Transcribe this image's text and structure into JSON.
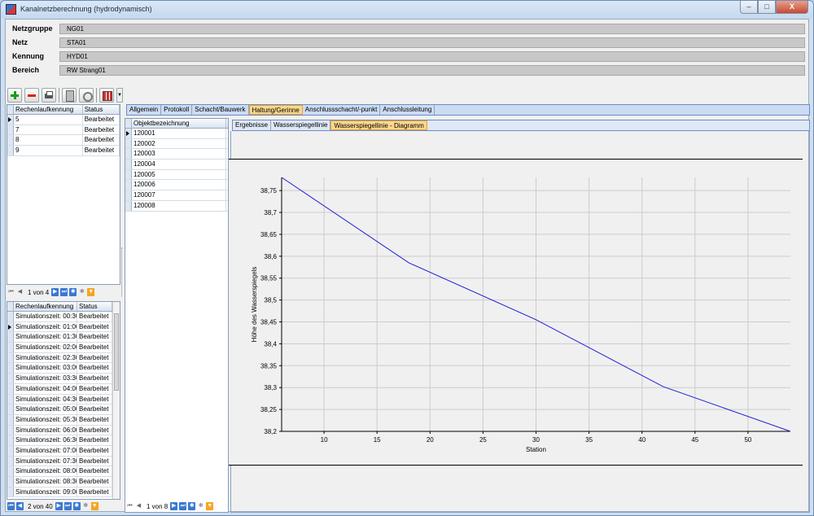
{
  "window": {
    "title": "Kanalnetzberechnung (hydrodynamisch)",
    "controls": [
      "–",
      "□",
      "X"
    ]
  },
  "header": {
    "rows": [
      {
        "label": "Netzgruppe",
        "value": "NG01"
      },
      {
        "label": "Netz",
        "value": "STA01"
      },
      {
        "label": "Kennung",
        "value": "HYD01"
      },
      {
        "label": "Bereich",
        "value": "RW Strang01"
      }
    ]
  },
  "toolbar": {
    "icons": [
      "add-icon",
      "delete-icon",
      "print-icon",
      "calculator-icon",
      "link-icon",
      "grid-icon"
    ]
  },
  "runs_grid": {
    "columns": [
      "Rechenlaufkennung",
      "Status"
    ],
    "rows": [
      {
        "id": "5",
        "status": "Bearbeitet"
      },
      {
        "id": "7",
        "status": "Bearbeitet"
      },
      {
        "id": "8",
        "status": "Bearbeitet"
      },
      {
        "id": "9",
        "status": "Bearbeitet"
      }
    ],
    "nav": {
      "position": "1 von 4"
    }
  },
  "sim_grid": {
    "columns": [
      "Rechenlaufkennung",
      "Status"
    ],
    "rows": [
      {
        "id": "Simulationszeit: 00:30",
        "status": "Bearbeitet"
      },
      {
        "id": "Simulationszeit: 01:00",
        "status": "Bearbeitet"
      },
      {
        "id": "Simulationszeit: 01:30",
        "status": "Bearbeitet"
      },
      {
        "id": "Simulationszeit: 02:00",
        "status": "Bearbeitet"
      },
      {
        "id": "Simulationszeit: 02:30",
        "status": "Bearbeitet"
      },
      {
        "id": "Simulationszeit: 03:00",
        "status": "Bearbeitet"
      },
      {
        "id": "Simulationszeit: 03:30",
        "status": "Bearbeitet"
      },
      {
        "id": "Simulationszeit: 04:00",
        "status": "Bearbeitet"
      },
      {
        "id": "Simulationszeit: 04:30",
        "status": "Bearbeitet"
      },
      {
        "id": "Simulationszeit: 05:00",
        "status": "Bearbeitet"
      },
      {
        "id": "Simulationszeit: 05:30",
        "status": "Bearbeitet"
      },
      {
        "id": "Simulationszeit: 06:00",
        "status": "Bearbeitet"
      },
      {
        "id": "Simulationszeit: 06:30",
        "status": "Bearbeitet"
      },
      {
        "id": "Simulationszeit: 07:00",
        "status": "Bearbeitet"
      },
      {
        "id": "Simulationszeit: 07:30",
        "status": "Bearbeitet"
      },
      {
        "id": "Simulationszeit: 08:00",
        "status": "Bearbeitet"
      },
      {
        "id": "Simulationszeit: 08:30",
        "status": "Bearbeitet"
      },
      {
        "id": "Simulationszeit: 09:00",
        "status": "Bearbeitet"
      }
    ],
    "nav": {
      "position": "2 von 40"
    }
  },
  "main_tabs": [
    "Allgemein",
    "Protokoll",
    "Schacht/Bauwerk",
    "Haltung/Gerinne",
    "Anschlussschacht/-punkt",
    "Anschlussleitung"
  ],
  "main_tabs_active": 3,
  "objects_grid": {
    "column": "Objektbezeichnung",
    "rows": [
      "120001",
      "120002",
      "120003",
      "120004",
      "120005",
      "120006",
      "120007",
      "120008"
    ],
    "nav": {
      "position": "1 von 8"
    }
  },
  "sub_tabs": [
    "Ergebnisse",
    "Wasserspiegellinie",
    "Wasserspiegellinie - Diagramm"
  ],
  "sub_tabs_active": 2,
  "colors": {
    "line": "#1f1fd8",
    "active_tab": "#fbd78c",
    "grid": "#cccccc"
  },
  "chart_data": {
    "type": "line",
    "xlabel": "Station",
    "ylabel": "Höhe des Wasserspiegels",
    "xlim": [
      6,
      54
    ],
    "ylim": [
      38.2,
      38.78
    ],
    "x_ticks": [
      10,
      15,
      20,
      25,
      30,
      35,
      40,
      45,
      50
    ],
    "y_ticks": [
      "38,2",
      "38,25",
      "38,3",
      "38,35",
      "38,4",
      "38,45",
      "38,5",
      "38,55",
      "38,6",
      "38,65",
      "38,7",
      "38,75"
    ],
    "grid": true,
    "series": [
      {
        "x": [
          6,
          18,
          30,
          42,
          54
        ],
        "y": [
          38.78,
          38.585,
          38.455,
          38.302,
          38.2
        ]
      }
    ]
  }
}
